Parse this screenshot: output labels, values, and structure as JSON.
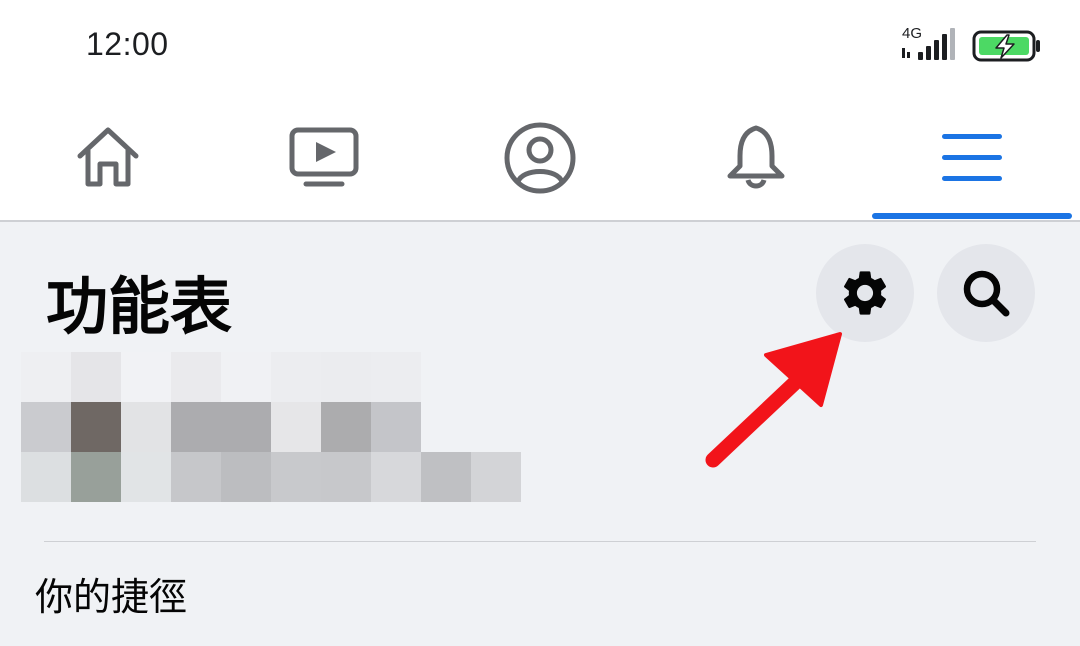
{
  "status_bar": {
    "time": "12:00",
    "network_type": "4G",
    "signal_icon": "cellular-signal-icon",
    "battery_icon": "battery-charging-icon",
    "battery_color": "#4cd964"
  },
  "nav_tabs": [
    {
      "id": "home",
      "icon": "home-icon",
      "active": false
    },
    {
      "id": "watch",
      "icon": "video-play-icon",
      "active": false
    },
    {
      "id": "profile",
      "icon": "profile-icon",
      "active": false
    },
    {
      "id": "notifications",
      "icon": "bell-icon",
      "active": false
    },
    {
      "id": "menu",
      "icon": "hamburger-menu-icon",
      "active": true
    }
  ],
  "colors": {
    "accent": "#1b74e4",
    "background": "#f0f2f5",
    "button_bg": "#e4e6eb",
    "annotation_arrow": "#f2141a"
  },
  "main": {
    "title": "功能表",
    "settings_icon": "gear-icon",
    "search_icon": "search-icon",
    "profile_pixelated": true,
    "section_title": "你的捷徑"
  }
}
